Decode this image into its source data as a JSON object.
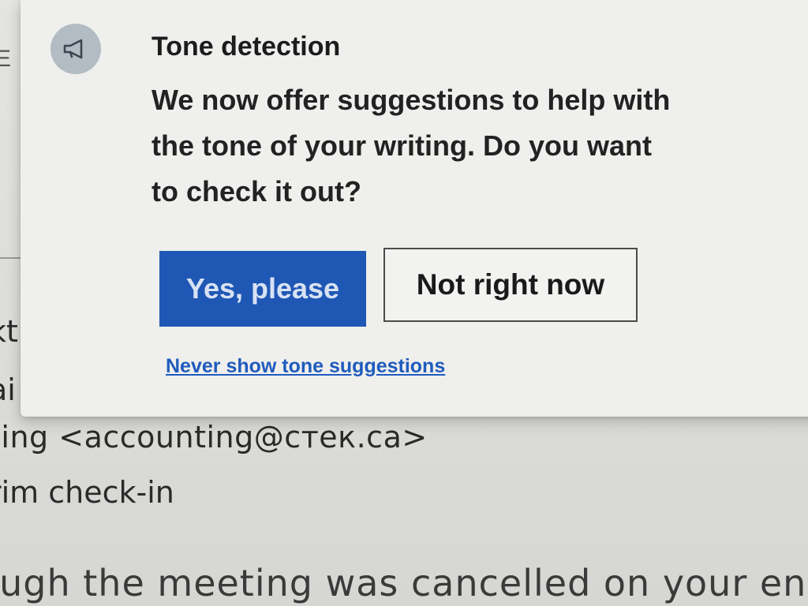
{
  "callout": {
    "title": "Tone detection",
    "body": "We now offer suggestions to help with the tone of your writing. Do you want to check it out?",
    "icon": "megaphone-icon",
    "accept_label": "Yes, please",
    "decline_label": "Not right now",
    "never_link": "Never show tone suggestions",
    "accent_color": "#1f57b5"
  },
  "email": {
    "edge_char": "E",
    "fragment_1": "kt",
    "fragment_2": "ai",
    "from": "ting <accounting@стек.ca>",
    "subject": "rim check-in",
    "body_line": "ough the meeting was cancelled on your en"
  }
}
